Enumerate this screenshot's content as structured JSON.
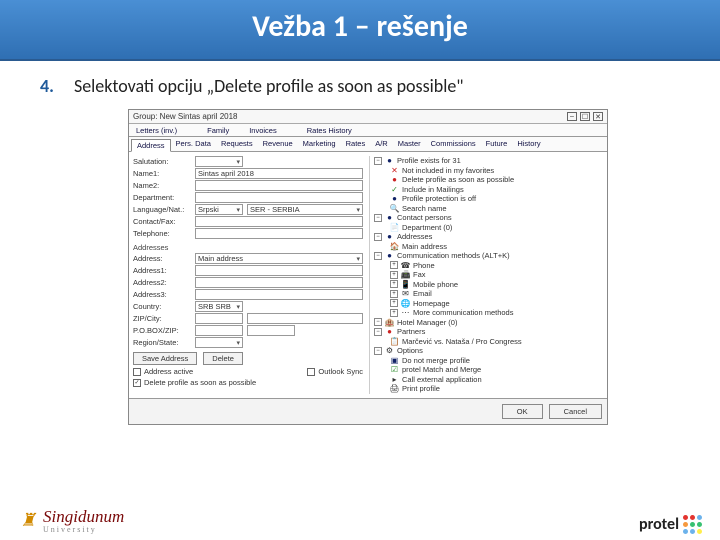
{
  "slide": {
    "title": "Vežba 1 – rešenje",
    "step_number": "4.",
    "step_text": "Selektovati opciju „Delete profile as soon as possible\""
  },
  "window": {
    "title": "Group: New Sintas april 2018",
    "ctrl_min": "‒",
    "ctrl_max": "☐",
    "ctrl_close": "✕"
  },
  "tabs_row1": [
    "Letters (inv.)",
    "",
    "",
    "Family",
    "",
    "Invoices",
    "",
    "",
    "Rates History"
  ],
  "tabs_row2": [
    "Address",
    "Pers. Data",
    "Requests",
    "Revenue",
    "Marketing",
    "Rates",
    "A/R",
    "Master",
    "Commissions",
    "Future",
    "History"
  ],
  "form": {
    "salutation_lbl": "Salutation:",
    "name1_lbl": "Name1:",
    "name1_val": "Sintas april 2018",
    "name2_lbl": "Name2:",
    "dept_lbl": "Department:",
    "lang_lbl": "Language/Nat.:",
    "lang_val": "Srpski",
    "lang2_val": "SER - SERBIA",
    "contact_lbl": "Contact/Fax:",
    "telephone_lbl": "Telephone:",
    "section_addr": "Addresses",
    "address_lbl": "Address:",
    "address_val": "Main address",
    "address1_lbl": "Address1:",
    "address2_lbl": "Address2:",
    "address3_lbl": "Address3:",
    "country_lbl": "Country:",
    "country_val": "SRB  SRB",
    "zip_lbl": "ZIP/City:",
    "pobox_lbl": "P.O.BOX/ZIP:",
    "region_lbl": "Region/State:",
    "btn_save": "Save Address",
    "btn_delete": "Delete",
    "chk1_lbl": "Address active",
    "chk1_txt": "Outlook Sync",
    "chk2_lbl": "Delete profile as soon as possible",
    "chk2_mark": "✓"
  },
  "tree": [
    {
      "ind": 0,
      "tg": "−",
      "ic": "●",
      "cls": "blue",
      "txt": "Profile exists for 31"
    },
    {
      "ind": 1,
      "ic": "✕",
      "cls": "red",
      "txt": "Not included in my favorites"
    },
    {
      "ind": 1,
      "ic": "●",
      "cls": "red",
      "txt": "Delete profile as soon as possible"
    },
    {
      "ind": 1,
      "ic": "✓",
      "cls": "green",
      "txt": "Include in Mailings"
    },
    {
      "ind": 1,
      "ic": "●",
      "cls": "blue",
      "txt": "Profile protection is off"
    },
    {
      "ind": 1,
      "ic": "🔍",
      "cls": "",
      "txt": "Search name"
    },
    {
      "ind": 0,
      "tg": "−",
      "ic": "●",
      "cls": "blue",
      "txt": "Contact persons"
    },
    {
      "ind": 1,
      "ic": "📄",
      "cls": "",
      "txt": "Department (0)"
    },
    {
      "ind": 0,
      "tg": "−",
      "ic": "●",
      "cls": "blue",
      "txt": "Addresses"
    },
    {
      "ind": 1,
      "ic": "🏠",
      "cls": "orange",
      "txt": "Main address"
    },
    {
      "ind": 0,
      "tg": "−",
      "ic": "●",
      "cls": "blue",
      "txt": "Communication methods (ALT+K)"
    },
    {
      "ind": 1,
      "tg": "+",
      "ic": "☎",
      "cls": "",
      "txt": "Phone"
    },
    {
      "ind": 1,
      "tg": "+",
      "ic": "📠",
      "cls": "",
      "txt": "Fax"
    },
    {
      "ind": 1,
      "tg": "+",
      "ic": "📱",
      "cls": "",
      "txt": "Mobile phone"
    },
    {
      "ind": 1,
      "tg": "+",
      "ic": "✉",
      "cls": "",
      "txt": "Email"
    },
    {
      "ind": 1,
      "tg": "+",
      "ic": "🌐",
      "cls": "",
      "txt": "Homepage"
    },
    {
      "ind": 1,
      "tg": "+",
      "ic": "⋯",
      "cls": "",
      "txt": "More communication methods"
    },
    {
      "ind": 0,
      "tg": "−",
      "ic": "🏨",
      "cls": "",
      "txt": "Hotel Manager (0)"
    },
    {
      "ind": 0,
      "tg": "−",
      "ic": "●",
      "cls": "red",
      "txt": "Partners"
    },
    {
      "ind": 1,
      "ic": "📋",
      "cls": "",
      "txt": "Marčević vs. Nataša / Pro Congress"
    },
    {
      "ind": 0,
      "tg": "−",
      "ic": "⚙",
      "cls": "",
      "txt": "Options"
    },
    {
      "ind": 1,
      "ic": "▣",
      "cls": "blue",
      "txt": "Do not merge profile"
    },
    {
      "ind": 1,
      "ic": "☑",
      "cls": "green",
      "txt": "protel Match and Merge"
    },
    {
      "ind": 1,
      "ic": "▸",
      "cls": "",
      "txt": "Call external application"
    },
    {
      "ind": 1,
      "ic": "🖨",
      "cls": "",
      "txt": "Print profile"
    }
  ],
  "footer_buttons": {
    "ok": "OK",
    "cancel": "Cancel"
  },
  "logos": {
    "left_name": "Singidunum",
    "left_sub": "University",
    "right_name": "protel"
  },
  "dot_colors": [
    "#e3342f",
    "#e3342f",
    "#6cb2eb",
    "#f6993f",
    "#38c172",
    "#38c172",
    "#6cb2eb",
    "#6cb2eb",
    "#ffed4a"
  ]
}
